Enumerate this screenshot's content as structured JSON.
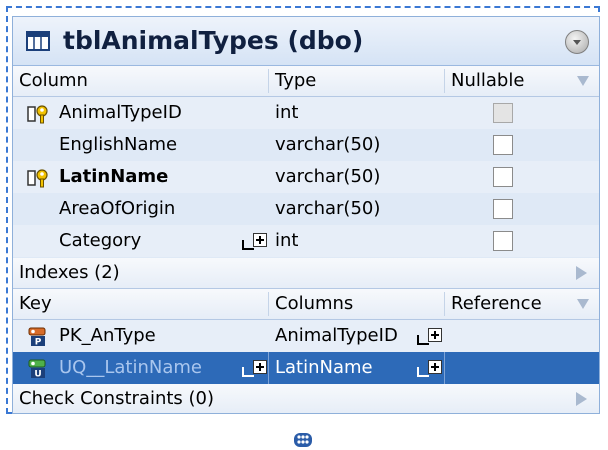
{
  "table": {
    "title": "tblAnimalTypes (dbo)"
  },
  "columns_header": {
    "column": "Column",
    "type": "Type",
    "nullable": "Nullable"
  },
  "columns": [
    {
      "name": "AnimalTypeID",
      "type": "int",
      "key": true,
      "bold": false,
      "nullable_disabled": true
    },
    {
      "name": "EnglishName",
      "type": "varchar(50)",
      "key": false,
      "bold": false,
      "nullable_disabled": false
    },
    {
      "name": "LatinName",
      "type": "varchar(50)",
      "key": true,
      "bold": true,
      "nullable_disabled": false
    },
    {
      "name": "AreaOfOrigin",
      "type": "varchar(50)",
      "key": false,
      "bold": false,
      "nullable_disabled": false
    },
    {
      "name": "Category",
      "type": "int",
      "key": false,
      "bold": false,
      "nullable_disabled": false
    }
  ],
  "indexes": {
    "label": "Indexes (2)"
  },
  "keys_header": {
    "key": "Key",
    "columns": "Columns",
    "reference": "Reference"
  },
  "keys": [
    {
      "name": "PK_AnType",
      "column": "AnimalTypeID",
      "badge": "P",
      "selected": false
    },
    {
      "name": "UQ__LatinName",
      "column": "LatinName",
      "badge": "U",
      "selected": true
    }
  ],
  "check_constraints": {
    "label": "Check Constraints (0)"
  },
  "colors": {
    "dash_border": "#3a78d4",
    "selected_row": "#2d6ab8",
    "panel_bg": "#dfe9f6"
  },
  "icons": [
    "table-icon",
    "collapse-icon",
    "key-column-icon",
    "primary-key-icon",
    "unique-key-icon",
    "expand-plus-icon",
    "move-handle-icon"
  ]
}
